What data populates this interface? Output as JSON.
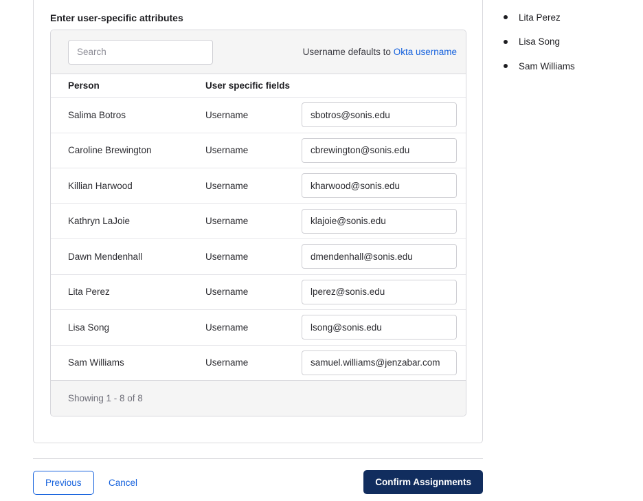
{
  "page": {
    "heading": "Enter user-specific attributes"
  },
  "toolbar": {
    "search_placeholder": "Search",
    "note_prefix": "Username defaults to ",
    "note_link": "Okta username"
  },
  "table": {
    "columns": {
      "person": "Person",
      "fields": "User specific fields"
    },
    "rows": [
      {
        "name": "Salima Botros",
        "field_label": "Username",
        "value": "sbotros@sonis.edu"
      },
      {
        "name": "Caroline Brewington",
        "field_label": "Username",
        "value": "cbrewington@sonis.edu"
      },
      {
        "name": "Killian Harwood",
        "field_label": "Username",
        "value": "kharwood@sonis.edu"
      },
      {
        "name": "Kathryn LaJoie",
        "field_label": "Username",
        "value": "klajoie@sonis.edu"
      },
      {
        "name": "Dawn Mendenhall",
        "field_label": "Username",
        "value": "dmendenhall@sonis.edu"
      },
      {
        "name": "Lita Perez",
        "field_label": "Username",
        "value": "lperez@sonis.edu"
      },
      {
        "name": "Lisa Song",
        "field_label": "Username",
        "value": "lsong@sonis.edu"
      },
      {
        "name": "Sam Williams",
        "field_label": "Username",
        "value": "samuel.williams@jenzabar.com"
      }
    ],
    "footer": "Showing 1 - 8 of 8"
  },
  "sidebar": {
    "items": [
      "Lita Perez",
      "Lisa Song",
      "Sam Williams"
    ]
  },
  "actions": {
    "previous": "Previous",
    "cancel": "Cancel",
    "confirm": "Confirm Assignments"
  },
  "colors": {
    "accent": "#1662dd",
    "confirm_bg": "#112d5e",
    "panel_bg": "#f5f5f5",
    "border": "#d7d7dc",
    "text": "#1d1d21",
    "muted": "#6e6e78"
  }
}
